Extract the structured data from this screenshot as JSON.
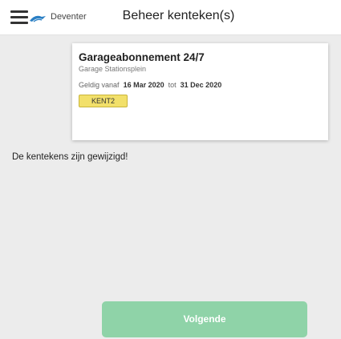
{
  "header": {
    "city": "Deventer",
    "title": "Beheer kenteken(s)",
    "menu_icon": "hamburger-menu-icon",
    "logo_icon": "deventer-logo-icon"
  },
  "subscription": {
    "name": "Garageabonnement 24/7",
    "location": "Garage Stationsplein",
    "valid_from_label": "Geldig vanaf",
    "valid_from": "16 Mar 2020",
    "valid_to_label": "tot",
    "valid_to": "31 Dec 2020",
    "plates": [
      "KENT2"
    ]
  },
  "message": "De kentekens zijn gewijzigd!",
  "footer": {
    "next_label": "Volgende"
  },
  "colors": {
    "background": "#ececec",
    "plate": "#f2e06a",
    "next_button": "#8fd3a8",
    "logo": "#2a7fc4"
  }
}
